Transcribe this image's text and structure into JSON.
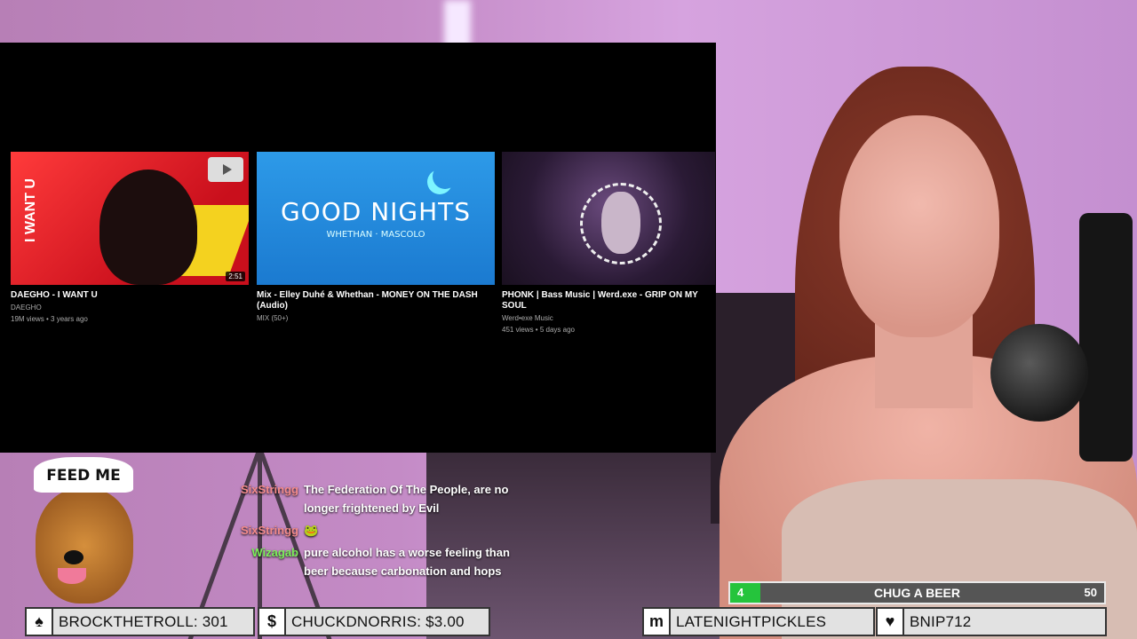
{
  "videos": [
    {
      "title": "DAEGHO - I WANT U ",
      "channel": "DAEGHO",
      "meta": "19M views • 3 years ago",
      "duration": "2:51",
      "thumb_text": "I WANT U"
    },
    {
      "title": "Mix - Elley Duhé & Whethan - MONEY ON THE DASH (Audio)",
      "channel": "",
      "meta": "MIX (50+)",
      "thumb_title": "GOOD NIGHTS",
      "thumb_sub": "WHETHAN · MASCOLO"
    },
    {
      "title": "PHONK | Bass Music | Werd.exe - GRIP ON MY SOUL",
      "channel": "Werd•exe Music",
      "meta": "451 views • 5 days ago"
    }
  ],
  "chat": [
    {
      "user": "SixStringg",
      "color": "#f28a8a",
      "message": "The Federation Of The People, are no longer frightened by Evil"
    },
    {
      "user": "SixStringg",
      "color": "#f28a8a",
      "message": "🐸"
    },
    {
      "user": "Wizagab",
      "color": "#7cf05a",
      "message": "pure alcohol has a worse feeling than beer because carbonation and hops"
    }
  ],
  "overlay": {
    "feed_me": "FEED ME"
  },
  "bottom_bars": [
    {
      "icon": "♠",
      "text": "BROCKTHETROLL: 301"
    },
    {
      "icon": "$",
      "text": "CHUCKDNORRIS: $3.00"
    },
    {
      "icon": "m",
      "text": "LATENIGHTPICKLES"
    },
    {
      "icon": "♥",
      "text": "BNIP712"
    }
  ],
  "goal": {
    "label": "CHUG A BEER",
    "current": "4",
    "target": "50",
    "progress": 0.08,
    "color": "#25c43c"
  }
}
